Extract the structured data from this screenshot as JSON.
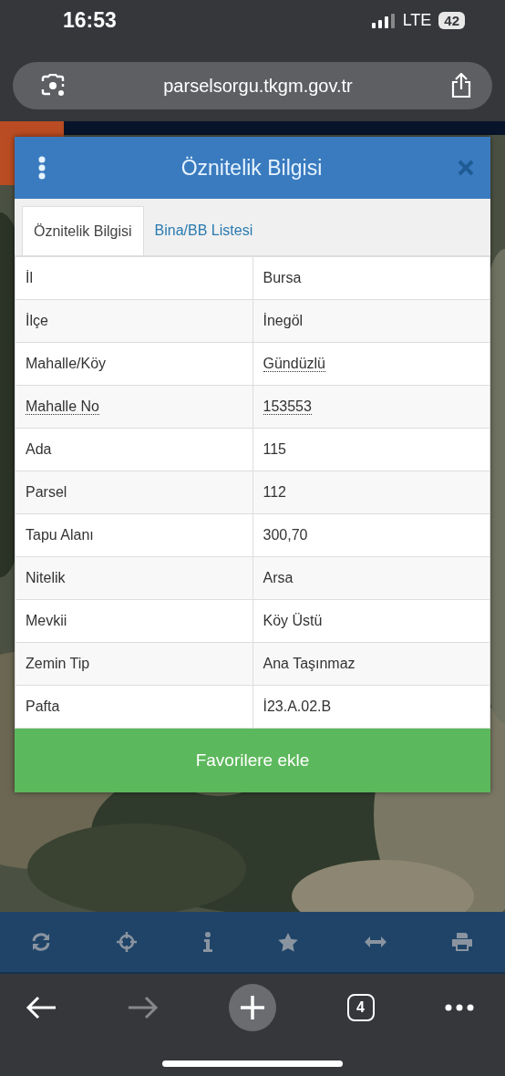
{
  "status_bar": {
    "time": "16:53",
    "network": "LTE",
    "battery": "42"
  },
  "address_bar": {
    "url": "parselsorgu.tkgm.gov.tr"
  },
  "dialog": {
    "title": "Öznitelik Bilgisi",
    "tabs": [
      {
        "label": "Öznitelik Bilgisi",
        "selected": true
      },
      {
        "label": "Bina/BB Listesi",
        "selected": false
      }
    ],
    "rows": [
      {
        "label": "İl",
        "value": "Bursa",
        "label_dotted": false,
        "value_dotted": false
      },
      {
        "label": "İlçe",
        "value": "İnegöl",
        "label_dotted": false,
        "value_dotted": false
      },
      {
        "label": "Mahalle/Köy",
        "value": "Gündüzlü",
        "label_dotted": false,
        "value_dotted": true
      },
      {
        "label": "Mahalle No",
        "value": "153553",
        "label_dotted": true,
        "value_dotted": true
      },
      {
        "label": "Ada",
        "value": "115",
        "label_dotted": false,
        "value_dotted": false
      },
      {
        "label": "Parsel",
        "value": "112",
        "label_dotted": false,
        "value_dotted": false
      },
      {
        "label": "Tapu Alanı",
        "value": "300,70",
        "label_dotted": false,
        "value_dotted": false
      },
      {
        "label": "Nitelik",
        "value": "Arsa",
        "label_dotted": false,
        "value_dotted": false
      },
      {
        "label": "Mevkii",
        "value": "Köy Üstü",
        "label_dotted": false,
        "value_dotted": false
      },
      {
        "label": "Zemin Tip",
        "value": "Ana Taşınmaz",
        "label_dotted": false,
        "value_dotted": false
      },
      {
        "label": "Pafta",
        "value": "İ23.A.02.B",
        "label_dotted": false,
        "value_dotted": false
      }
    ],
    "button": "Favorilere ekle"
  },
  "browser_bar": {
    "tab_count": "4",
    "forward_disabled": true
  }
}
